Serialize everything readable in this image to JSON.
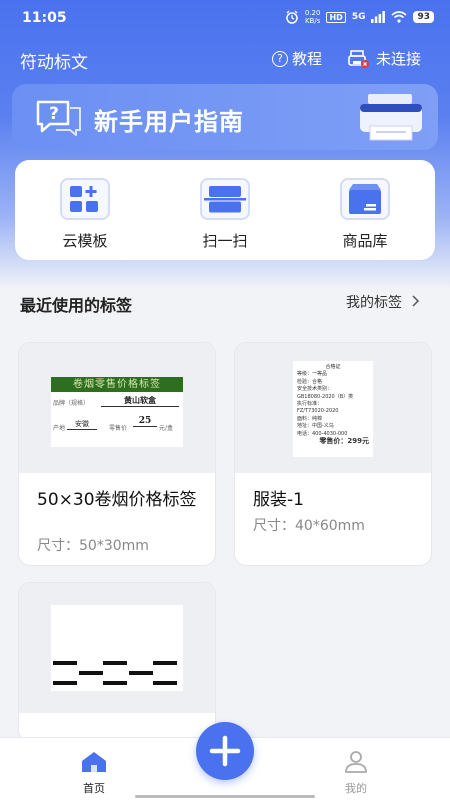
{
  "status_bar": {
    "time": "11:05",
    "net_speed_value": "0.20",
    "net_speed_unit": "KB/s",
    "hd": "HD",
    "signal": "5G",
    "battery": "93"
  },
  "topbar": {
    "app_title": "符动标文",
    "tutorial_label": "教程",
    "connect_label": "未连接"
  },
  "guide_banner": {
    "text": "新手用户指南"
  },
  "quick_actions": [
    {
      "label": "云模板",
      "icon": "cloud-template-icon"
    },
    {
      "label": "扫一扫",
      "icon": "scan-icon"
    },
    {
      "label": "商品库",
      "icon": "product-library-icon"
    }
  ],
  "recent": {
    "title": "最近使用的标签",
    "my_labels": "我的标签"
  },
  "cards": [
    {
      "name": "50×30卷烟价格标签",
      "size": "尺寸：50*30mm",
      "preview": {
        "header": "卷烟零售价格标签",
        "brand_label": "品牌（规格）",
        "brand_value": "黄山软盒",
        "origin_label": "产地",
        "origin_value": "安徽",
        "price_label": "零售价",
        "price_value": "25",
        "price_unit": "元/盒"
      }
    },
    {
      "name": "服装-1",
      "size": "尺寸：40*60mm",
      "preview": {
        "title": "合格证",
        "lines": [
          "等级：一等品",
          "检验：合格",
          "安全技术类别：",
          "GB18080-2020（B）类",
          "执行标准：",
          "FZ/T73020-2020",
          "面料：纯棉",
          "地址：中国-义乌",
          "电话：400-4030-000"
        ],
        "price": "零售价：299元"
      }
    },
    {
      "name": "",
      "size": "",
      "preview": {
        "type": "barcode-lines"
      }
    }
  ],
  "bottom_nav": {
    "home_label": "首页",
    "mine_label": "我的"
  },
  "colors": {
    "primary": "#4a72ee",
    "tobacco_header_bg": "#2e6e1f"
  }
}
